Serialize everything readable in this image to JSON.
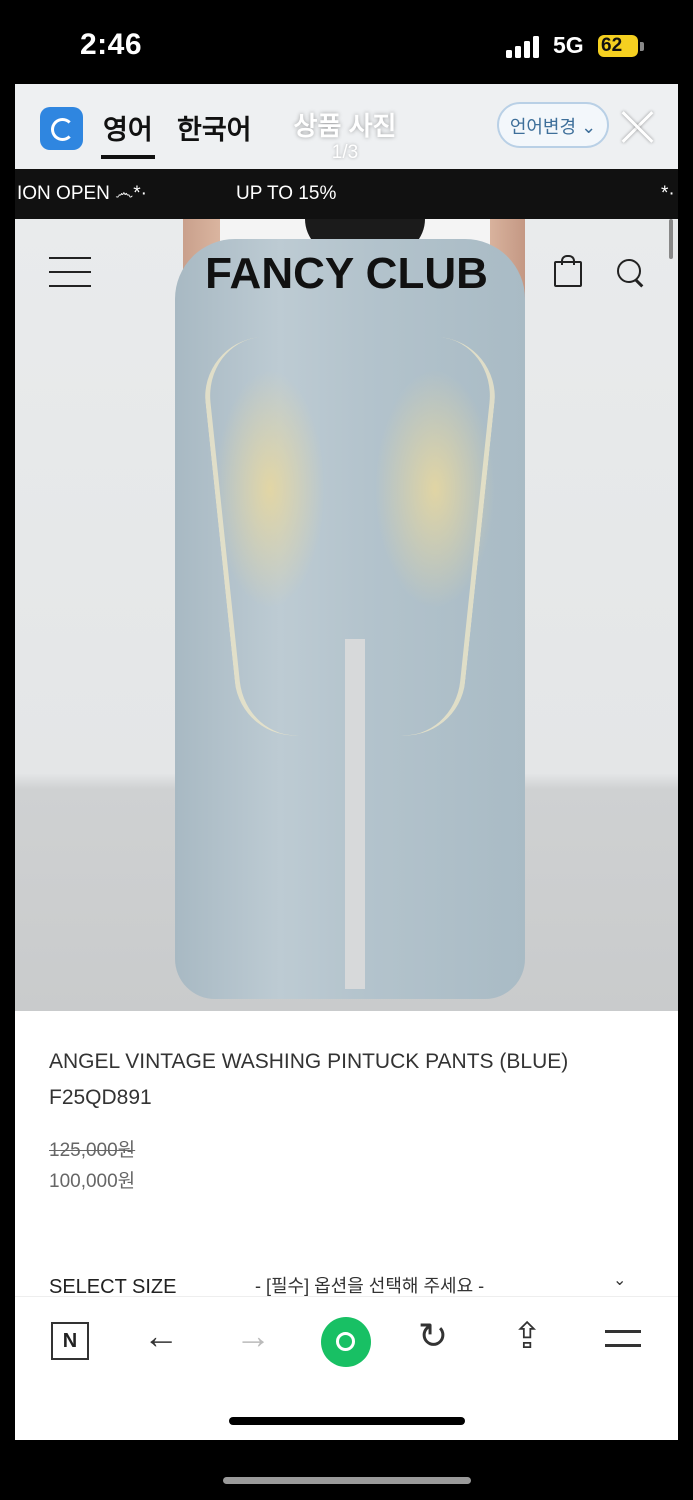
{
  "status_bar": {
    "time": "2:46",
    "network": "5G",
    "battery": "62"
  },
  "translator": {
    "lang_source": "영어",
    "lang_target": "한국어",
    "title": "상품 사진",
    "page": "1/3",
    "change_language": "언어변경",
    "accent_color": "#2f86e0"
  },
  "marquee": {
    "items": [
      "ION OPEN ෴*·",
      "UP TO 15%",
      "*·"
    ]
  },
  "store": {
    "logo": "FANCY CLUB"
  },
  "product": {
    "name": "ANGEL VINTAGE WASHING PINTUCK PANTS (BLUE)",
    "code": "F25QD891",
    "original_price": "125,000원",
    "sale_price": "100,000원",
    "select_label": "SELECT SIZE",
    "select_placeholder": "- [필수] 옵션을 선택해 주세요 -"
  },
  "toolbar": {
    "n_label": "N",
    "back": "←",
    "forward": "→",
    "refresh": "↻",
    "share": "⇪",
    "green_color": "#18c064"
  }
}
